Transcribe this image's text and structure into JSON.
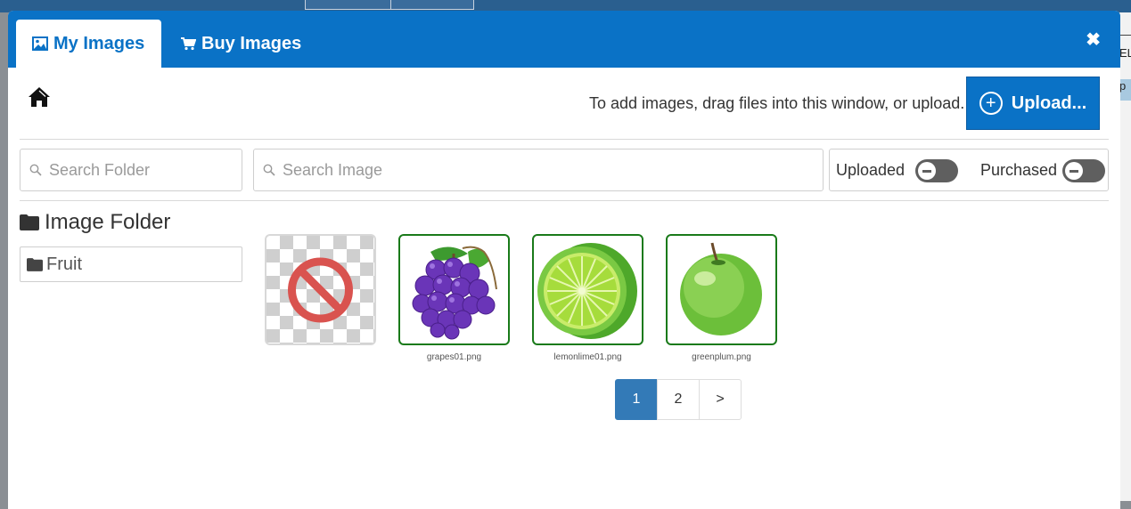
{
  "background": {
    "right_edge_text_1": "EL",
    "right_edge_text_2": "p"
  },
  "tabs": [
    {
      "label": "My Images",
      "icon": "image-icon",
      "active": true
    },
    {
      "label": "Buy Images",
      "icon": "cart-icon",
      "active": false
    }
  ],
  "close_label": "✖",
  "toolbar": {
    "home_icon": "home-icon",
    "hint": "To add images, drag files into this window, or upload.",
    "upload_label": "Upload..."
  },
  "search": {
    "folder_placeholder": "Search Folder",
    "image_placeholder": "Search Image"
  },
  "filters": {
    "uploaded_label": "Uploaded",
    "purchased_label": "Purchased",
    "uploaded_on": false,
    "purchased_on": false
  },
  "sidebar": {
    "title": "Image Folder",
    "folders": [
      {
        "name": "Fruit"
      }
    ]
  },
  "images": [
    {
      "name": "",
      "icon": "no-image-icon"
    },
    {
      "name": "grapes01.png",
      "icon": "grapes-icon"
    },
    {
      "name": "lemonlime01.png",
      "icon": "lime-icon"
    },
    {
      "name": "greenplum.png",
      "icon": "green-apple-icon"
    }
  ],
  "pagination": {
    "pages": [
      "1",
      "2",
      ">"
    ],
    "current": "1"
  },
  "colors": {
    "brand_blue": "#0a72c6",
    "thumb_border": "#1a7a1a",
    "pager_active": "#337ab7"
  }
}
